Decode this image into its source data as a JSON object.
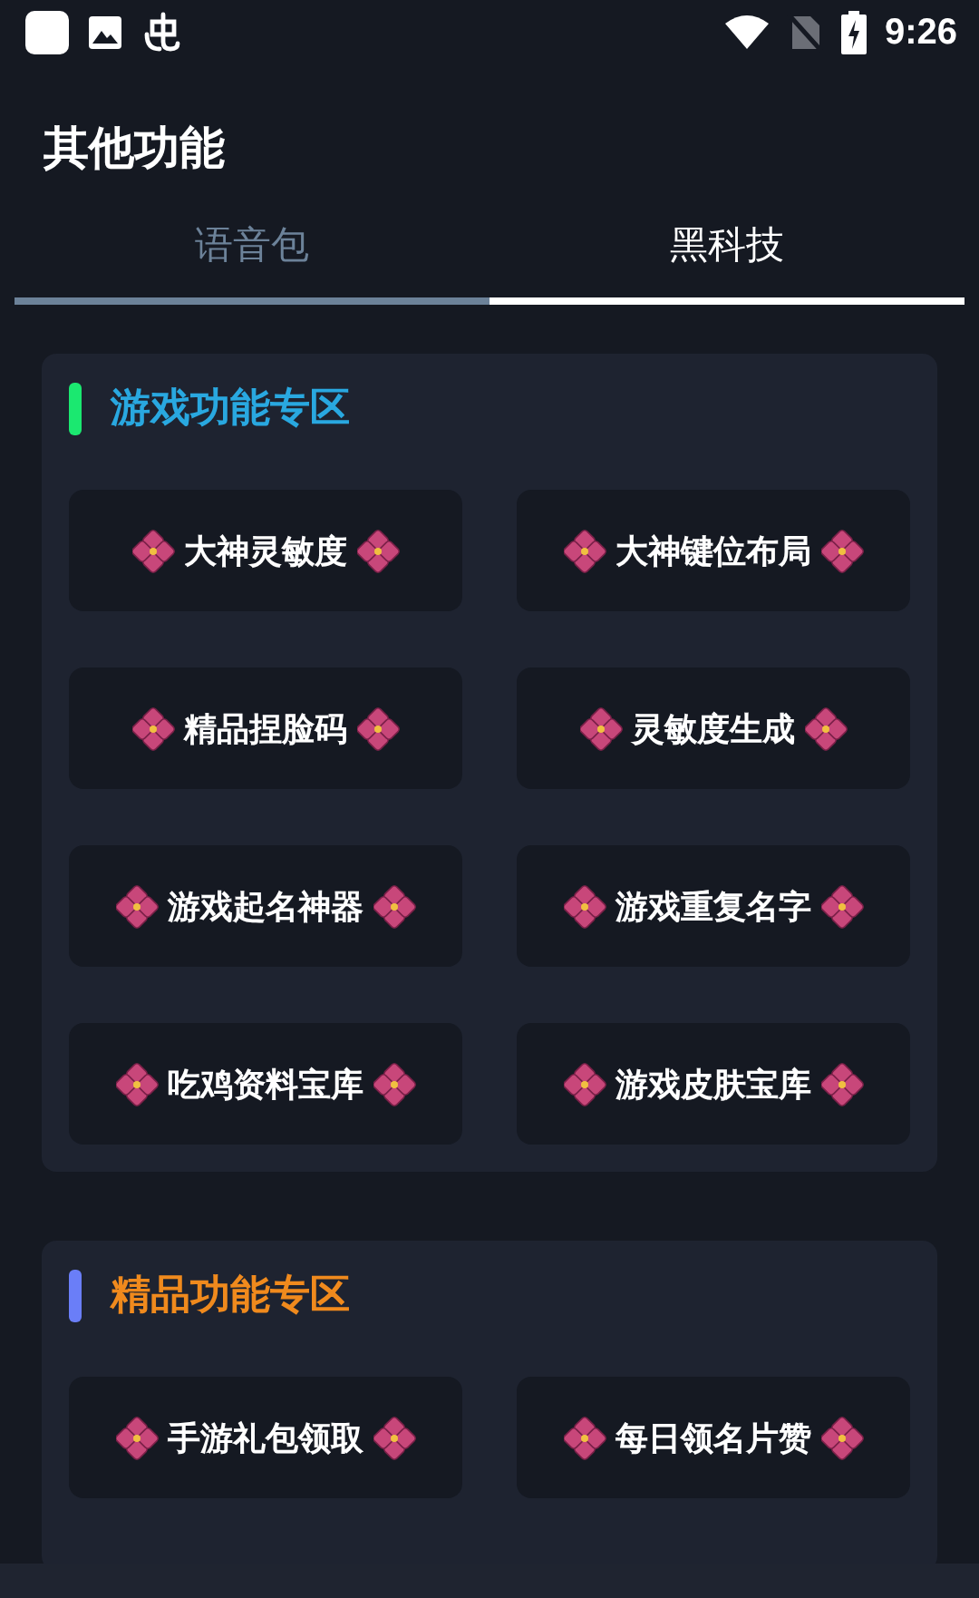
{
  "status_bar": {
    "time": "9:26"
  },
  "header": {
    "title": "其他功能"
  },
  "tabs": [
    {
      "label": "语音包",
      "selected": false
    },
    {
      "label": "黑科技",
      "selected": true
    }
  ],
  "sections": [
    {
      "title": "游戏功能专区",
      "color": "#29a8e0",
      "accent": {
        "color": "#1be870"
      },
      "items": [
        "大神灵敏度",
        "大神键位布局",
        "精品捏脸码",
        "灵敏度生成",
        "游戏起名神器",
        "游戏重复名字",
        "吃鸡资料宝库",
        "游戏皮肤宝库"
      ]
    },
    {
      "title": "精品功能专区",
      "color": "#f08a1d",
      "accent": {
        "color": "#6a7ef8"
      },
      "items": [
        "手游礼包领取",
        "每日领名片赞"
      ]
    }
  ]
}
